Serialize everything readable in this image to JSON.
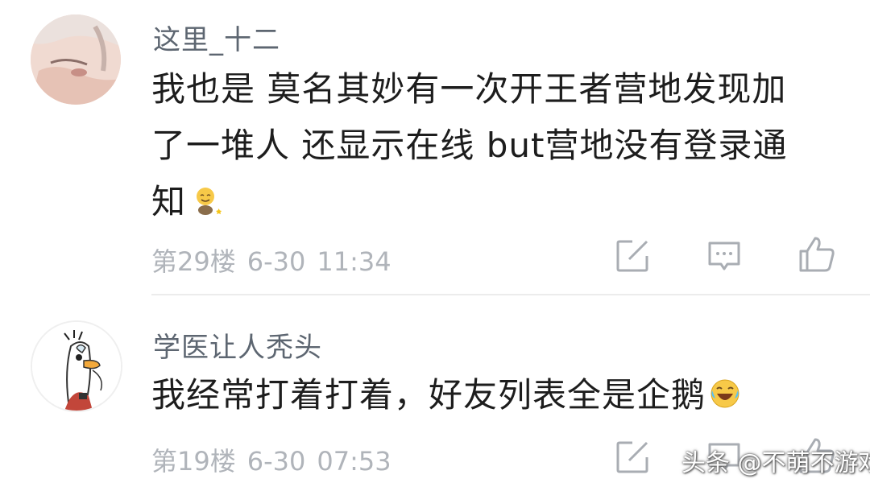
{
  "comments": [
    {
      "username": "这里_十二",
      "lines": [
        "我也是  莫名其妙有一次开王者营地发现加",
        "了一堆人  还显示在线  but营地没有登录通",
        "知"
      ],
      "emoji": "smile-emoji-icon",
      "floor": "第29楼",
      "date": "6-30",
      "time": "11:34"
    },
    {
      "username": "学医让人秃头",
      "lines": [
        "我经常打着打着，好友列表全是企鹅"
      ],
      "emoji": "laugh-cry-emoji-icon",
      "floor": "第19楼",
      "date": "6-30",
      "time": "07:53"
    }
  ],
  "watermark": "头条 @不萌不游戏",
  "colors": {
    "icon": "#a9adb3",
    "meta": "#b0b4ba",
    "username": "#5d6671"
  }
}
